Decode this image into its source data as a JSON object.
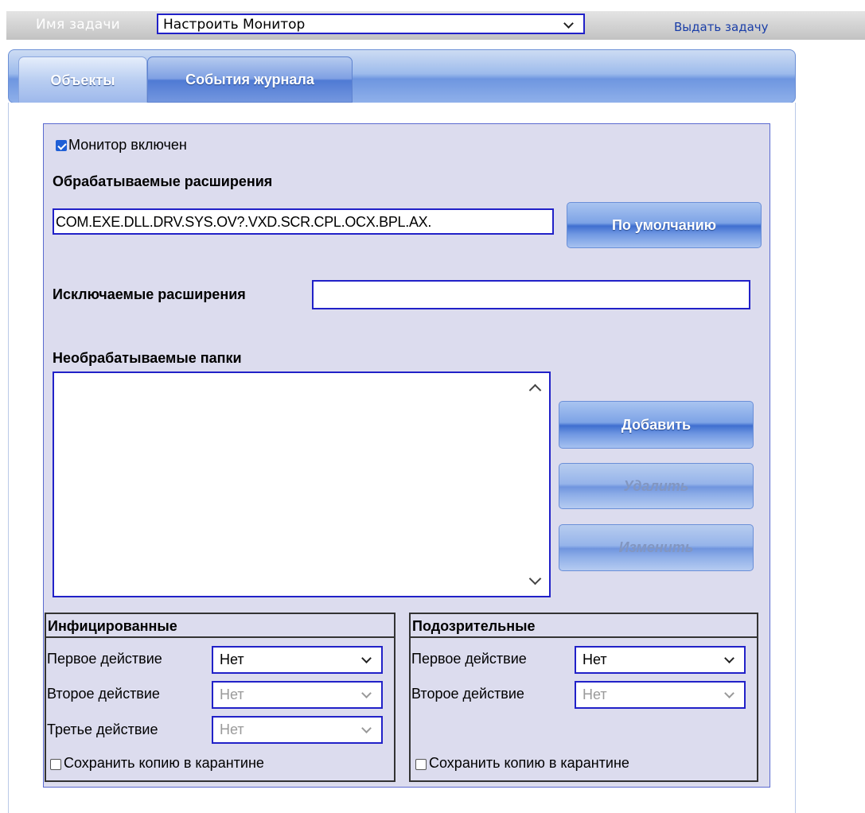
{
  "topbar": {
    "task_label": "Имя задачи",
    "task_select_value": "Настроить Монитор",
    "issue_link": "Выдать задачу"
  },
  "tabs": [
    {
      "label": "Объекты",
      "active": true
    },
    {
      "label": "События журнала",
      "active": false
    }
  ],
  "monitor": {
    "enabled_label": "Монитор включен",
    "enabled": true
  },
  "processed_extensions": {
    "title": "Обрабатываемые расширения",
    "value": "COM.EXE.DLL.DRV.SYS.OV?.VXD.SCR.CPL.OCX.BPL.AX.",
    "default_button": "По умолчанию"
  },
  "excluded_extensions": {
    "label": "Исключаемые расширения",
    "value": ""
  },
  "unprocessed_folders": {
    "title": "Необрабатываемые папки",
    "items": [],
    "add_button": "Добавить",
    "delete_button": "Удалить",
    "edit_button": "Изменить"
  },
  "infected": {
    "title": "Инфицированные",
    "first_action_label": "Первое действие",
    "first_action_value": "Нет",
    "second_action_label": "Второе действие",
    "second_action_value": "Нет",
    "third_action_label": "Третье действие",
    "third_action_value": "Нет",
    "quarantine_label": "Сохранить копию в карантине",
    "quarantine_checked": false
  },
  "suspicious": {
    "title": "Подозрительные",
    "first_action_label": "Первое действие",
    "first_action_value": "Нет",
    "second_action_label": "Второе действие",
    "second_action_value": "Нет",
    "quarantine_label": "Сохранить копию в карантине",
    "quarantine_checked": false
  },
  "colors": {
    "panel_bg": "#dcdcee",
    "field_border": "#2121c8",
    "tab_blue": "#4f7ad4"
  }
}
